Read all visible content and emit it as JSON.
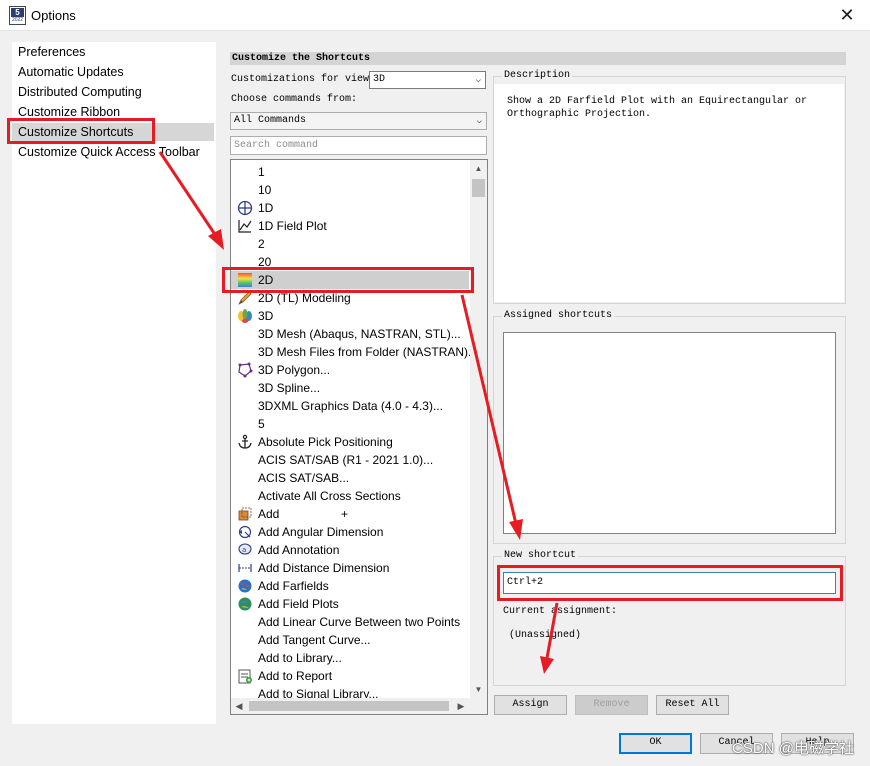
{
  "window": {
    "title": "Options",
    "close_glyph": "✕",
    "icon_top": "5",
    "icon_bottom": "2022"
  },
  "nav": {
    "items": [
      {
        "label": "Preferences"
      },
      {
        "label": "Automatic Updates"
      },
      {
        "label": "Distributed Computing"
      },
      {
        "label": "Customize Ribbon"
      },
      {
        "label": "Customize Shortcuts",
        "selected": true
      },
      {
        "label": "Customize Quick Access Toolbar"
      }
    ]
  },
  "panel": {
    "header": "Customize the Shortcuts",
    "view_label": "Customizations for view:",
    "view_value": "3D",
    "commands_label": "Choose commands from:",
    "commands_value": "All Commands",
    "search_placeholder": "Search command"
  },
  "commands": [
    {
      "label": "1",
      "icon": ""
    },
    {
      "label": "10",
      "icon": ""
    },
    {
      "label": "1D",
      "icon": "crosshair-circle-icon"
    },
    {
      "label": "1D Field Plot",
      "icon": "line-graph-icon"
    },
    {
      "label": "2",
      "icon": ""
    },
    {
      "label": "20",
      "icon": ""
    },
    {
      "label": "2D",
      "icon": "gradient-square-icon",
      "selected": true
    },
    {
      "label": "2D (TL) Modeling",
      "icon": "pencil-ruler-icon"
    },
    {
      "label": "3D",
      "icon": "3d-pattern-icon"
    },
    {
      "label": "3D Mesh (Abaqus, NASTRAN, STL)...",
      "icon": ""
    },
    {
      "label": "3D Mesh Files from Folder (NASTRAN)...",
      "icon": ""
    },
    {
      "label": "3D Polygon...",
      "icon": "polygon-icon"
    },
    {
      "label": "3D Spline...",
      "icon": ""
    },
    {
      "label": "3DXML Graphics Data (4.0 - 4.3)...",
      "icon": ""
    },
    {
      "label": "5",
      "icon": ""
    },
    {
      "label": "Absolute Pick Positioning",
      "icon": "anchor-icon"
    },
    {
      "label": "ACIS SAT/SAB (R1 - 2021 1.0)...",
      "icon": ""
    },
    {
      "label": "ACIS SAT/SAB...",
      "icon": ""
    },
    {
      "label": "Activate All Cross Sections",
      "icon": ""
    },
    {
      "label": "Add",
      "icon": "add-block-icon",
      "extra": "+"
    },
    {
      "label": "Add Angular Dimension",
      "icon": "angle-dimension-icon"
    },
    {
      "label": "Add Annotation",
      "icon": "annotation-icon"
    },
    {
      "label": "Add Distance Dimension",
      "icon": "distance-dimension-icon"
    },
    {
      "label": "Add Farfields",
      "icon": "farfield-globe-icon"
    },
    {
      "label": "Add Field Plots",
      "icon": "field-plot-globe-icon"
    },
    {
      "label": "Add Linear Curve Between two Points",
      "icon": ""
    },
    {
      "label": "Add Tangent Curve...",
      "icon": ""
    },
    {
      "label": "Add to Library...",
      "icon": ""
    },
    {
      "label": "Add to Report",
      "icon": "report-icon"
    },
    {
      "label": "Add to Signal Library...",
      "icon": ""
    }
  ],
  "description": {
    "title": "Description",
    "text": "Show a 2D Farfield Plot with an Equirectangular or\nOrthographic Projection."
  },
  "assigned": {
    "title": "Assigned shortcuts"
  },
  "new_shortcut": {
    "title": "New shortcut",
    "value": "Ctrl+2",
    "current_label": "Current assignment:",
    "current_value": "(Unassigned)"
  },
  "buttons": {
    "assign": "Assign",
    "remove": "Remove",
    "reset_all": "Reset All",
    "ok": "OK",
    "cancel": "Cancel",
    "help": "Help"
  },
  "watermark": "CSDN @电磁学社",
  "colors": {
    "annotation_red": "#e51c23",
    "selection_grey": "#d6d6d6",
    "focus_blue": "#0078d7"
  }
}
